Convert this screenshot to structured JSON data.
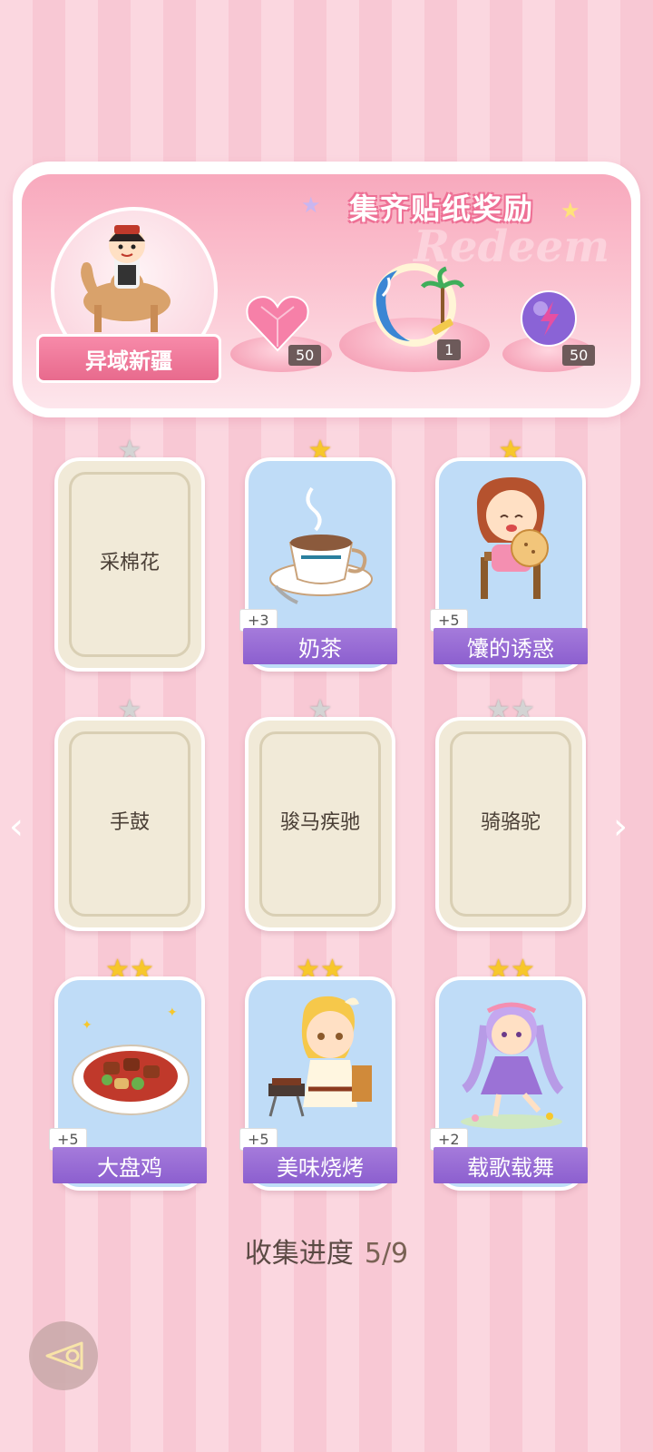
{
  "banner": {
    "title": "集齐贴纸奖励",
    "watermark": "Redeem",
    "region": "异域新疆",
    "rewards": [
      {
        "icon": "pink-heart-gem-icon",
        "count": "50"
      },
      {
        "icon": "beach-ring-frame-icon",
        "count": "1"
      },
      {
        "icon": "purple-energy-orb-icon",
        "count": "50"
      }
    ]
  },
  "cards": [
    {
      "name": "采棉花",
      "stars": 1,
      "unlocked": false,
      "bonus": ""
    },
    {
      "name": "奶茶",
      "stars": 1,
      "unlocked": true,
      "bonus": "+3",
      "icon": "milk-tea-cup-icon"
    },
    {
      "name": "馕的诱惑",
      "stars": 1,
      "unlocked": true,
      "bonus": "+5",
      "icon": "girl-eating-naan-icon"
    },
    {
      "name": "手鼓",
      "stars": 1,
      "unlocked": false,
      "bonus": ""
    },
    {
      "name": "骏马疾驰",
      "stars": 1,
      "unlocked": false,
      "bonus": ""
    },
    {
      "name": "骑骆驼",
      "stars": 2,
      "unlocked": false,
      "bonus": ""
    },
    {
      "name": "大盘鸡",
      "stars": 2,
      "unlocked": true,
      "bonus": "+5",
      "icon": "big-plate-chicken-icon"
    },
    {
      "name": "美味烧烤",
      "stars": 2,
      "unlocked": true,
      "bonus": "+5",
      "icon": "girl-bbq-icon"
    },
    {
      "name": "载歌载舞",
      "stars": 2,
      "unlocked": true,
      "bonus": "+2",
      "icon": "dancing-girl-icon"
    }
  ],
  "progress": {
    "label": "收集进度",
    "value": "5/9"
  },
  "colors": {
    "gold_star": "#f7c72b",
    "grey_star": "#d4d4d4",
    "name_bar": "#8c5fcf",
    "banner": "#f8a9bd"
  }
}
